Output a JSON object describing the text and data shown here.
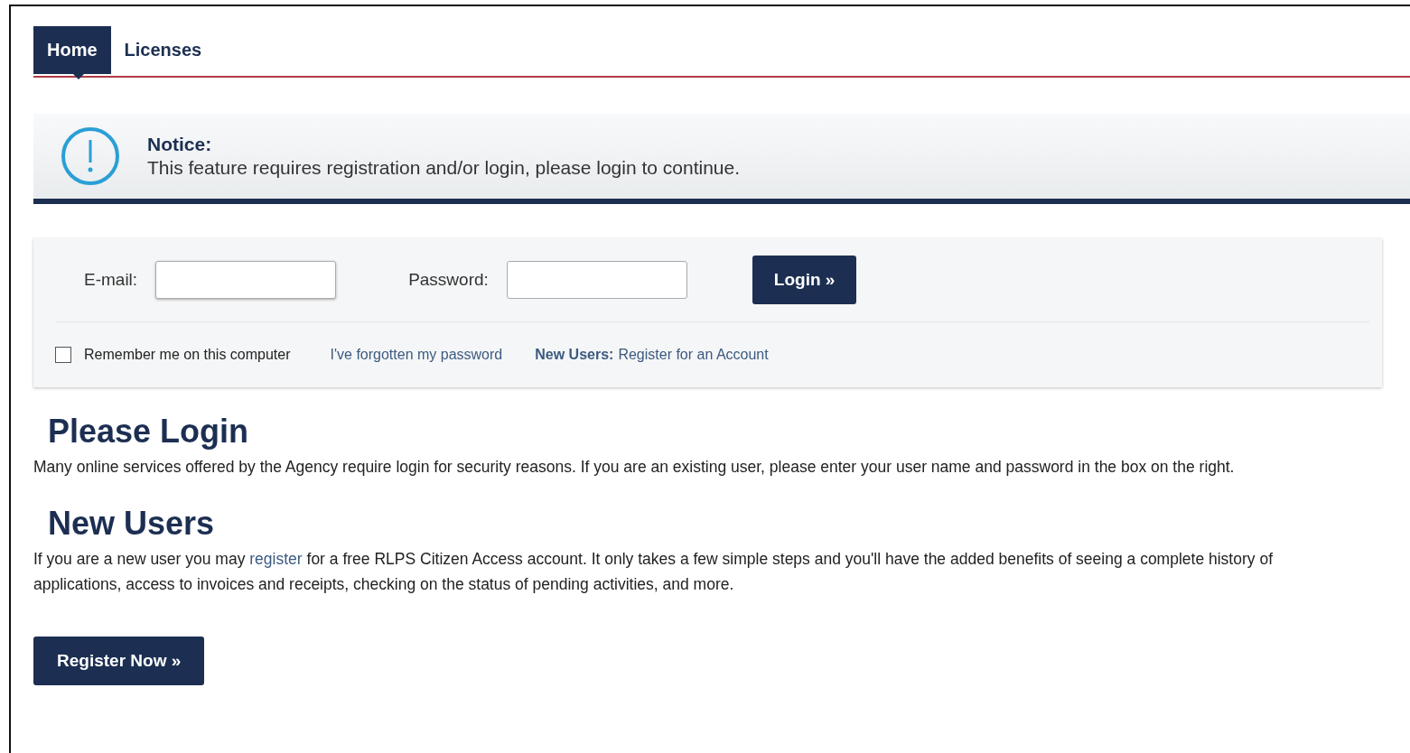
{
  "tabs": [
    {
      "label": "Home",
      "selected": true
    },
    {
      "label": "Licenses",
      "selected": false
    }
  ],
  "notice": {
    "title": "Notice:",
    "message": "This feature requires registration and/or login, please login to continue."
  },
  "login": {
    "email_label": "E-mail:",
    "password_label": "Password:",
    "button": "Login »",
    "remember": {
      "label": "Remember me on this computer",
      "checked": false
    },
    "forgot_link": "I've forgotten my password",
    "new_users_label": "New Users:",
    "register_link": "Register for an Account"
  },
  "sections": [
    {
      "heading": "Please Login",
      "text_before": "Many online services offered by the Agency require login for security reasons. If you are an existing user, please enter your user name and password in the box on the right."
    },
    {
      "heading": "New Users",
      "text_before": "If you are a new user you may ",
      "link": "register",
      "text_after": " for a free RLPS Citizen Access account. It only takes a few simple steps and you'll have the added benefits of seeing a complete history of applications, access to invoices and receipts, checking on the status of pending activities, and more."
    }
  ],
  "register_button": "Register Now »"
}
